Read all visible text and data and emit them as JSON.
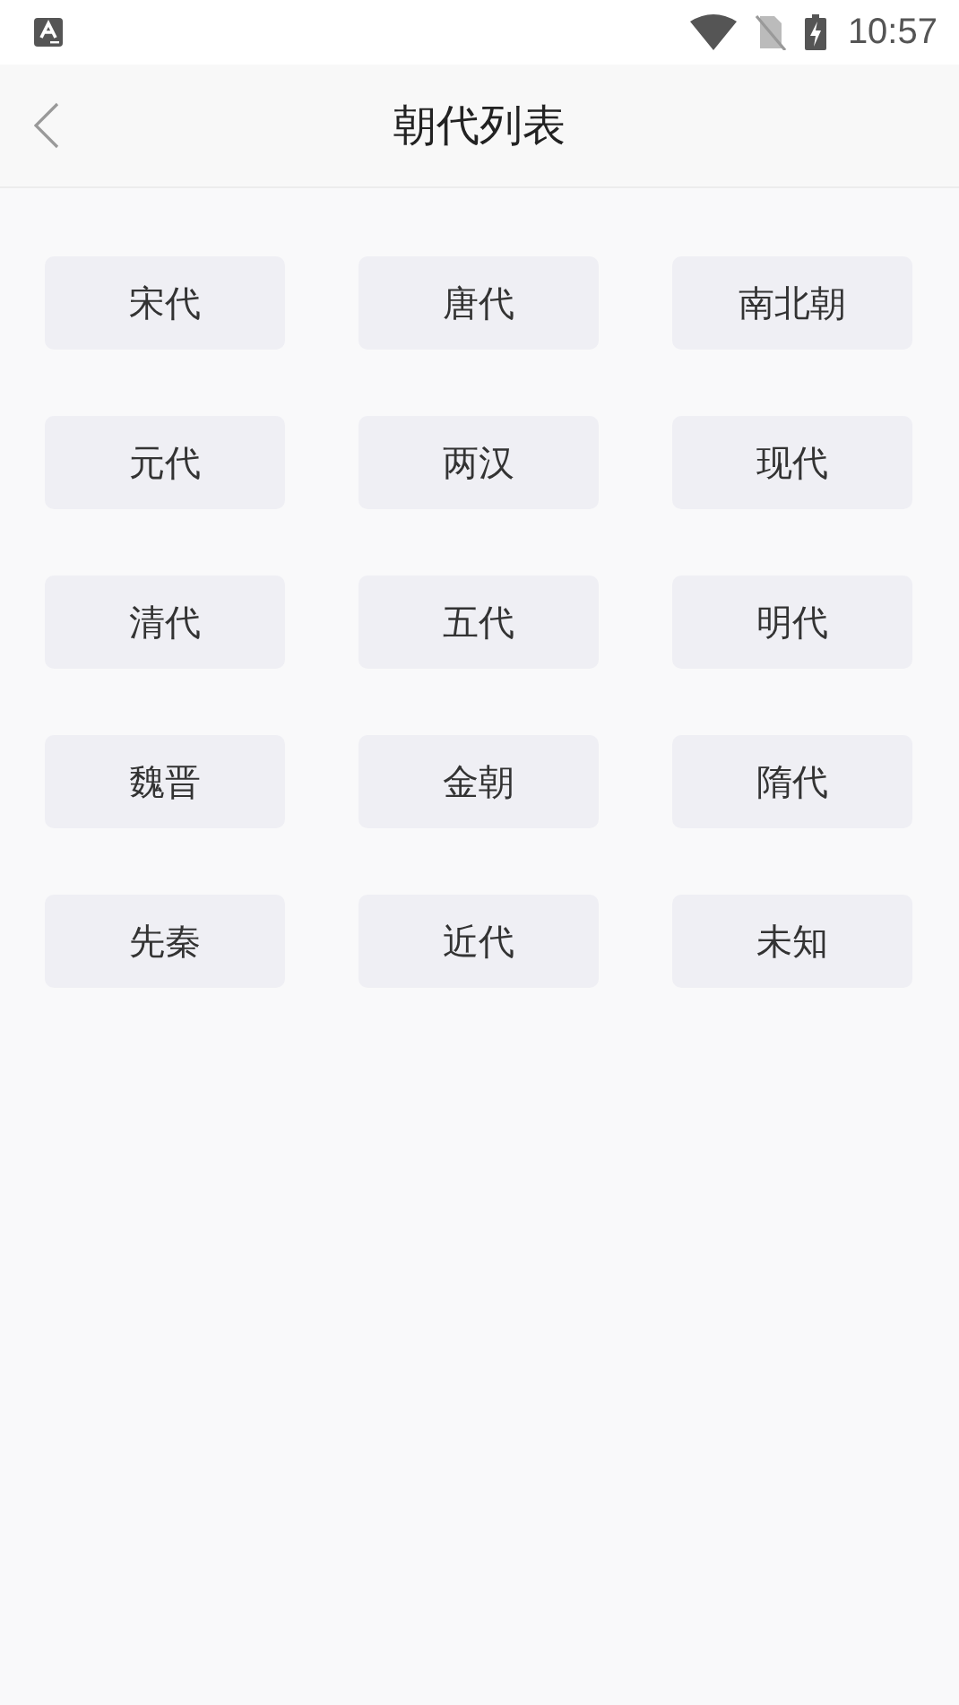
{
  "status_bar": {
    "time": "10:57"
  },
  "header": {
    "title": "朝代列表"
  },
  "dynasties": [
    "宋代",
    "唐代",
    "南北朝",
    "元代",
    "两汉",
    "现代",
    "清代",
    "五代",
    "明代",
    "魏晋",
    "金朝",
    "隋代",
    "先秦",
    "近代",
    "未知"
  ]
}
